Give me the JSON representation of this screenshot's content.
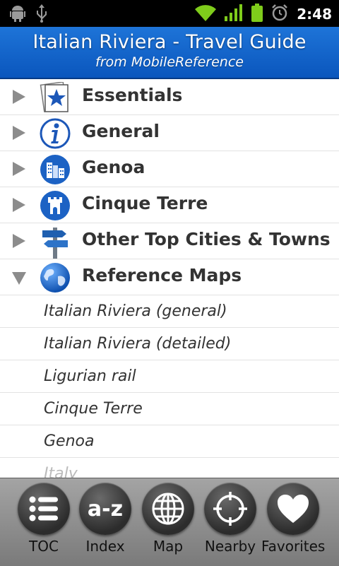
{
  "status_bar": {
    "time": "2:48",
    "icons": [
      "android-debug-icon",
      "usb-icon",
      "wifi-icon",
      "signal-icon",
      "battery-icon",
      "alarm-icon"
    ]
  },
  "header": {
    "title": "Italian Riviera - Travel Guide",
    "subtitle": "from MobileReference"
  },
  "toc": {
    "sections": [
      {
        "label": "Essentials",
        "icon": "essentials-star-icon",
        "expanded": false
      },
      {
        "label": "General",
        "icon": "info-icon",
        "expanded": false
      },
      {
        "label": "Genoa",
        "icon": "city-buildings-icon",
        "expanded": false
      },
      {
        "label": "Cinque Terre",
        "icon": "castle-tower-icon",
        "expanded": false
      },
      {
        "label": "Other Top Cities & Towns",
        "icon": "signpost-icon",
        "expanded": false
      },
      {
        "label": "Reference Maps",
        "icon": "globe-icon",
        "expanded": true
      }
    ],
    "reference_maps": [
      "Italian Riviera (general)",
      "Italian Riviera (detailed)",
      "Ligurian rail",
      "Cinque Terre",
      "Genoa",
      "Italy"
    ]
  },
  "bottom_bar": {
    "tabs": [
      {
        "label": "TOC",
        "icon": "list-icon"
      },
      {
        "label": "Index",
        "icon": "a-z-icon",
        "glyph": "a-z"
      },
      {
        "label": "Map",
        "icon": "globe-grid-icon"
      },
      {
        "label": "Nearby",
        "icon": "crosshair-icon"
      },
      {
        "label": "Favorites",
        "icon": "heart-icon"
      }
    ]
  },
  "colors": {
    "header_blue": "#0a56bd",
    "text": "#333333",
    "divider": "#e2e2e2"
  }
}
